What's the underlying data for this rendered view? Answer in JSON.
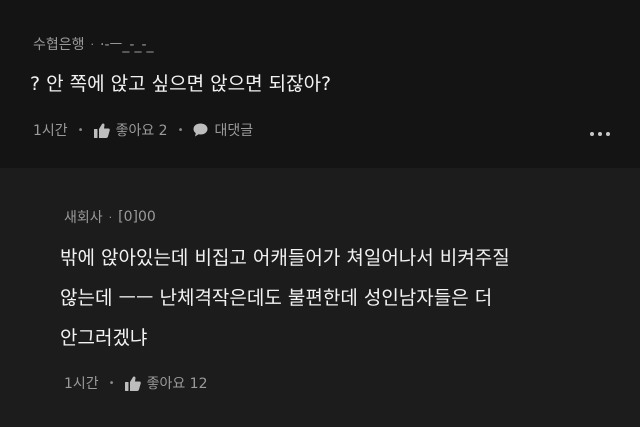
{
  "comment": {
    "author": "수협은행",
    "separator": "·",
    "nickname": "·-ㅡ_-_-_",
    "text": "? 안 쪽에 앉고 싶으면 앉으면 되잖아?",
    "time": "1시간",
    "like_label": "좋아요 2",
    "reply_label": "대댓글",
    "more_icon": "more-horizontal-icon"
  },
  "reply": {
    "author": "새회사",
    "separator": "·",
    "nickname": "[0]00",
    "lines": [
      "밖에 앉아있는데 비집고 어캐들어가 쳐일어나서 비켜주질",
      "않는데 ㅡㅡ 난체격작은데도 불편한데 성인남자들은 더",
      "안그러겠냐"
    ],
    "time": "1시간",
    "like_label": "좋아요 12"
  },
  "colors": {
    "background": "#000000",
    "comment_bg": "#141414",
    "reply_bg": "#1c1c1c",
    "meta_text": "#9a9a9a",
    "body_text": "#f2f2f2"
  }
}
